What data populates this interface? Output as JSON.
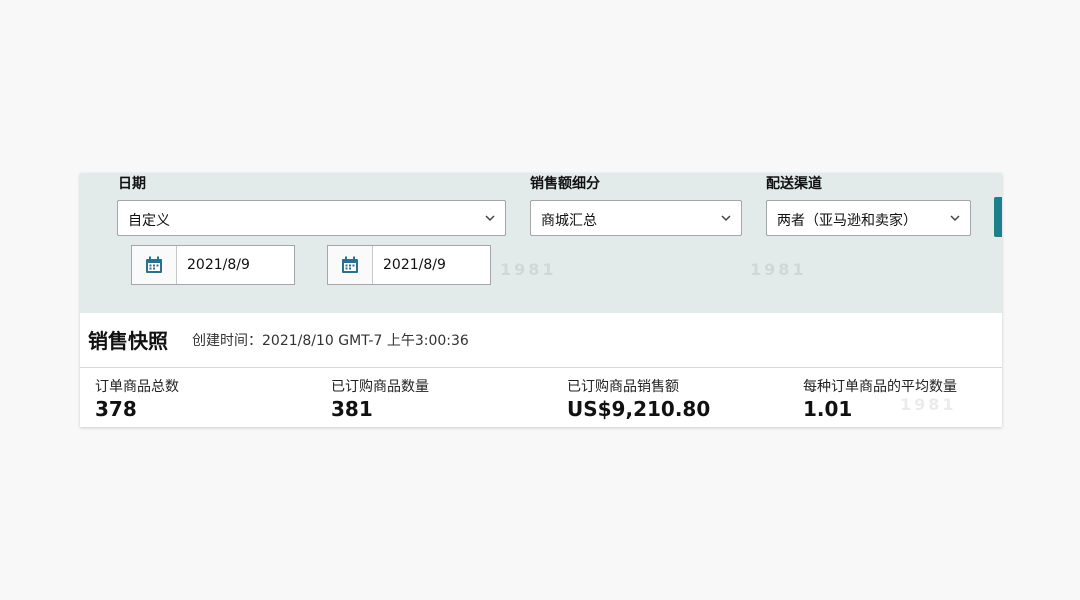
{
  "filters": {
    "date": {
      "label": "日期",
      "selected": "自定义",
      "start": "2021/8/9",
      "end": "2021/8/9"
    },
    "sales_breakdown": {
      "label": "销售额细分",
      "selected": "商城汇总"
    },
    "fulfillment_channel": {
      "label": "配送渠道",
      "selected": "两者（亚马逊和卖家）"
    }
  },
  "snapshot": {
    "title": "销售快照",
    "created_at": "创建时间：2021/8/10 GMT-7 上午3:00:36"
  },
  "metrics": [
    {
      "label": "订单商品总数",
      "value": "378"
    },
    {
      "label": "已订购商品数量",
      "value": "381"
    },
    {
      "label": "已订购商品销售额",
      "value": "US$9,210.80"
    },
    {
      "label": "每种订单商品的平均数量",
      "value": "1.01"
    }
  ],
  "colors": {
    "filter_panel_bg": "#e3eaea",
    "accent": "#1d7f8c",
    "calendar_icon": "#2d6f8e"
  },
  "watermark": "1981",
  "icons": {
    "calendar": "calendar-icon",
    "dropdown": "chevron-down-icon"
  }
}
